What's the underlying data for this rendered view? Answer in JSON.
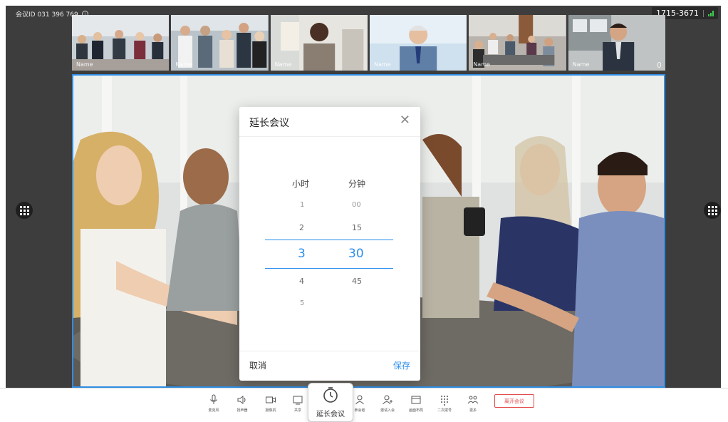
{
  "meeting": {
    "id_text": "会议ID 031 396 769",
    "info_icon": "info-icon",
    "number": "1715-3671"
  },
  "thumbnails": [
    {
      "name": "Name"
    },
    {
      "name": "Name"
    },
    {
      "name": "Name"
    },
    {
      "name": "Name"
    },
    {
      "name": "Name"
    },
    {
      "name": "Name"
    }
  ],
  "dialog": {
    "title": "延长会议",
    "hour_header": "小时",
    "minute_header": "分钟",
    "hours": [
      "1",
      "2",
      "3",
      "4",
      "5"
    ],
    "minutes": [
      "00",
      "15",
      "30",
      "45"
    ],
    "selected_hour": "3",
    "selected_minute": "30",
    "cancel": "取消",
    "save": "保存"
  },
  "toolbar": {
    "items": [
      {
        "label": "麦克风",
        "icon": "microphone-icon"
      },
      {
        "label": "扬声器",
        "icon": "speaker-icon"
      },
      {
        "label": "摄像机",
        "icon": "camera-icon"
      },
      {
        "label": "共享",
        "icon": "share-icon"
      },
      {
        "label": "参会者",
        "icon": "participants-icon"
      },
      {
        "label": "邀请入会",
        "icon": "invite-icon"
      },
      {
        "label": "画面布局",
        "icon": "layout-icon"
      },
      {
        "label": "二次拨号",
        "icon": "dialpad-icon"
      },
      {
        "label": "更多",
        "icon": "more-icon"
      }
    ],
    "extend_label": "延长会议",
    "leave_label": "离开会议"
  },
  "colors": {
    "accent": "#2b8ded",
    "leave": "#e34a4a"
  }
}
